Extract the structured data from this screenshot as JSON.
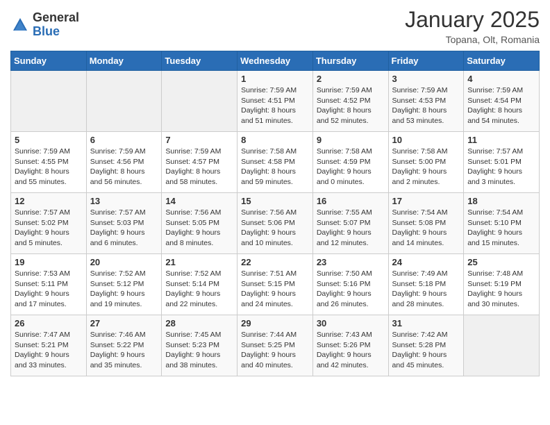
{
  "logo": {
    "general": "General",
    "blue": "Blue"
  },
  "title": "January 2025",
  "location": "Topana, Olt, Romania",
  "weekdays": [
    "Sunday",
    "Monday",
    "Tuesday",
    "Wednesday",
    "Thursday",
    "Friday",
    "Saturday"
  ],
  "weeks": [
    [
      {
        "day": "",
        "info": ""
      },
      {
        "day": "",
        "info": ""
      },
      {
        "day": "",
        "info": ""
      },
      {
        "day": "1",
        "info": "Sunrise: 7:59 AM\nSunset: 4:51 PM\nDaylight: 8 hours and 51 minutes."
      },
      {
        "day": "2",
        "info": "Sunrise: 7:59 AM\nSunset: 4:52 PM\nDaylight: 8 hours and 52 minutes."
      },
      {
        "day": "3",
        "info": "Sunrise: 7:59 AM\nSunset: 4:53 PM\nDaylight: 8 hours and 53 minutes."
      },
      {
        "day": "4",
        "info": "Sunrise: 7:59 AM\nSunset: 4:54 PM\nDaylight: 8 hours and 54 minutes."
      }
    ],
    [
      {
        "day": "5",
        "info": "Sunrise: 7:59 AM\nSunset: 4:55 PM\nDaylight: 8 hours and 55 minutes."
      },
      {
        "day": "6",
        "info": "Sunrise: 7:59 AM\nSunset: 4:56 PM\nDaylight: 8 hours and 56 minutes."
      },
      {
        "day": "7",
        "info": "Sunrise: 7:59 AM\nSunset: 4:57 PM\nDaylight: 8 hours and 58 minutes."
      },
      {
        "day": "8",
        "info": "Sunrise: 7:58 AM\nSunset: 4:58 PM\nDaylight: 8 hours and 59 minutes."
      },
      {
        "day": "9",
        "info": "Sunrise: 7:58 AM\nSunset: 4:59 PM\nDaylight: 9 hours and 0 minutes."
      },
      {
        "day": "10",
        "info": "Sunrise: 7:58 AM\nSunset: 5:00 PM\nDaylight: 9 hours and 2 minutes."
      },
      {
        "day": "11",
        "info": "Sunrise: 7:57 AM\nSunset: 5:01 PM\nDaylight: 9 hours and 3 minutes."
      }
    ],
    [
      {
        "day": "12",
        "info": "Sunrise: 7:57 AM\nSunset: 5:02 PM\nDaylight: 9 hours and 5 minutes."
      },
      {
        "day": "13",
        "info": "Sunrise: 7:57 AM\nSunset: 5:03 PM\nDaylight: 9 hours and 6 minutes."
      },
      {
        "day": "14",
        "info": "Sunrise: 7:56 AM\nSunset: 5:05 PM\nDaylight: 9 hours and 8 minutes."
      },
      {
        "day": "15",
        "info": "Sunrise: 7:56 AM\nSunset: 5:06 PM\nDaylight: 9 hours and 10 minutes."
      },
      {
        "day": "16",
        "info": "Sunrise: 7:55 AM\nSunset: 5:07 PM\nDaylight: 9 hours and 12 minutes."
      },
      {
        "day": "17",
        "info": "Sunrise: 7:54 AM\nSunset: 5:08 PM\nDaylight: 9 hours and 14 minutes."
      },
      {
        "day": "18",
        "info": "Sunrise: 7:54 AM\nSunset: 5:10 PM\nDaylight: 9 hours and 15 minutes."
      }
    ],
    [
      {
        "day": "19",
        "info": "Sunrise: 7:53 AM\nSunset: 5:11 PM\nDaylight: 9 hours and 17 minutes."
      },
      {
        "day": "20",
        "info": "Sunrise: 7:52 AM\nSunset: 5:12 PM\nDaylight: 9 hours and 19 minutes."
      },
      {
        "day": "21",
        "info": "Sunrise: 7:52 AM\nSunset: 5:14 PM\nDaylight: 9 hours and 22 minutes."
      },
      {
        "day": "22",
        "info": "Sunrise: 7:51 AM\nSunset: 5:15 PM\nDaylight: 9 hours and 24 minutes."
      },
      {
        "day": "23",
        "info": "Sunrise: 7:50 AM\nSunset: 5:16 PM\nDaylight: 9 hours and 26 minutes."
      },
      {
        "day": "24",
        "info": "Sunrise: 7:49 AM\nSunset: 5:18 PM\nDaylight: 9 hours and 28 minutes."
      },
      {
        "day": "25",
        "info": "Sunrise: 7:48 AM\nSunset: 5:19 PM\nDaylight: 9 hours and 30 minutes."
      }
    ],
    [
      {
        "day": "26",
        "info": "Sunrise: 7:47 AM\nSunset: 5:21 PM\nDaylight: 9 hours and 33 minutes."
      },
      {
        "day": "27",
        "info": "Sunrise: 7:46 AM\nSunset: 5:22 PM\nDaylight: 9 hours and 35 minutes."
      },
      {
        "day": "28",
        "info": "Sunrise: 7:45 AM\nSunset: 5:23 PM\nDaylight: 9 hours and 38 minutes."
      },
      {
        "day": "29",
        "info": "Sunrise: 7:44 AM\nSunset: 5:25 PM\nDaylight: 9 hours and 40 minutes."
      },
      {
        "day": "30",
        "info": "Sunrise: 7:43 AM\nSunset: 5:26 PM\nDaylight: 9 hours and 42 minutes."
      },
      {
        "day": "31",
        "info": "Sunrise: 7:42 AM\nSunset: 5:28 PM\nDaylight: 9 hours and 45 minutes."
      },
      {
        "day": "",
        "info": ""
      }
    ]
  ]
}
